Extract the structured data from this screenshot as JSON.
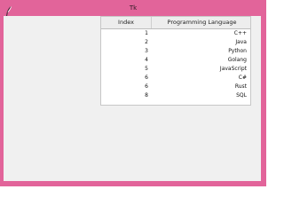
{
  "window": {
    "title": "Tk",
    "accent_color": "#e2649a",
    "client_bg": "#f0f0f0",
    "icon": "feather-icon"
  },
  "table": {
    "columns": [
      "Index",
      "Programming Language"
    ],
    "rows": [
      {
        "index": "1",
        "language": "C++"
      },
      {
        "index": "2",
        "language": "Java"
      },
      {
        "index": "3",
        "language": "Python"
      },
      {
        "index": "4",
        "language": "Golang"
      },
      {
        "index": "5",
        "language": "JavaScript"
      },
      {
        "index": "6",
        "language": "C#"
      },
      {
        "index": "6",
        "language": "Rust"
      },
      {
        "index": "8",
        "language": "SQL"
      }
    ]
  }
}
